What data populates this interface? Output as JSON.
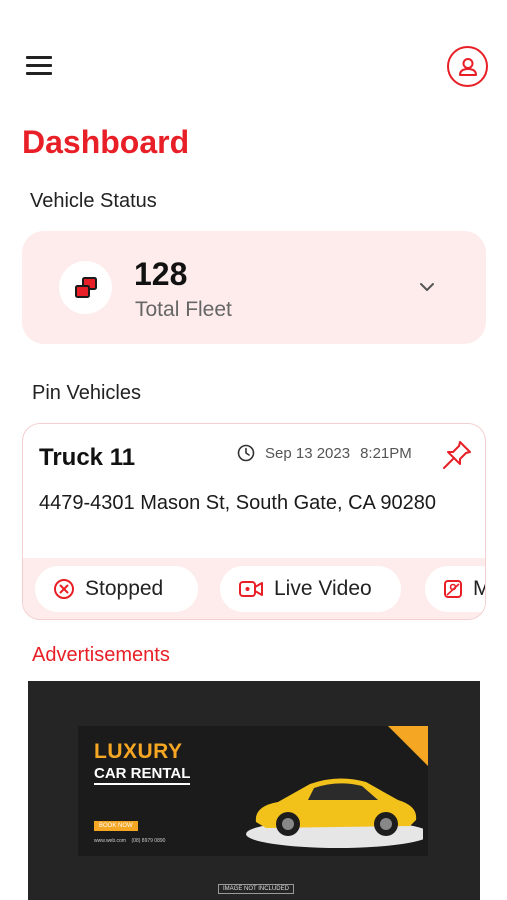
{
  "header": {
    "menu_icon": "hamburger-menu-icon",
    "profile_icon": "user-profile-icon",
    "accent_color": "#e81f26"
  },
  "page_title": "Dashboard",
  "vehicle_status": {
    "section_label": "Vehicle Status",
    "count": "128",
    "label": "Total Fleet",
    "icon": "fleet-icon",
    "expand_icon": "chevron-down-icon"
  },
  "pin_vehicles": {
    "section_label": "Pin Vehicles",
    "card": {
      "name": "Truck 11",
      "date": "Sep 13 2023",
      "time": "8:21PM",
      "address": "4479-4301 Mason St, South Gate, CA 90280",
      "chips": [
        {
          "label": "Stopped",
          "icon": "stopped-icon"
        },
        {
          "label": "Live Video",
          "icon": "video-camera-icon"
        },
        {
          "label": "M",
          "icon": "map-icon"
        }
      ]
    }
  },
  "advertisements": {
    "section_label": "Advertisements",
    "banner": {
      "headline": "LUXURY",
      "subheadline": "CAR RENTAL",
      "cta": "BOOK NOW",
      "website": "www.web.com",
      "phone": "(08) 8979 0890",
      "disclaimer": "IMAGE NOT INCLUDED"
    }
  }
}
